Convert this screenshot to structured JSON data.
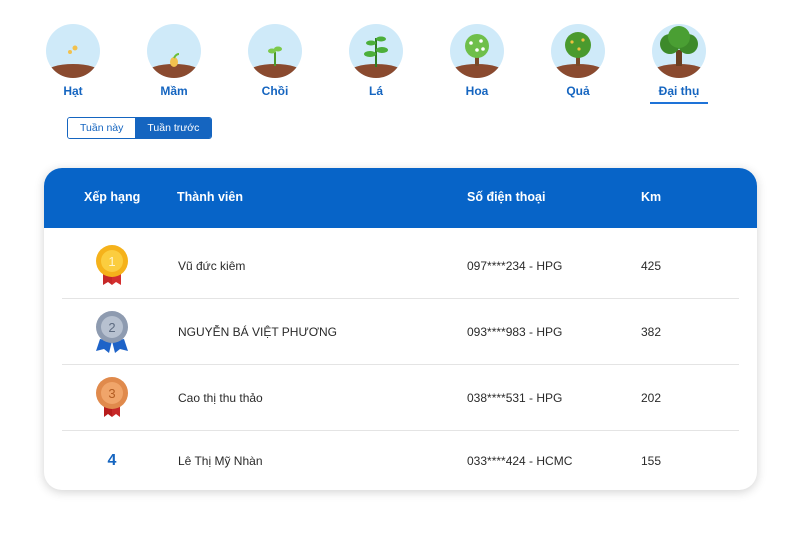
{
  "stages": [
    {
      "label": "Hạt",
      "icon": "seed-icon"
    },
    {
      "label": "Mầm",
      "icon": "sprout-icon"
    },
    {
      "label": "Chồi",
      "icon": "bud-icon"
    },
    {
      "label": "Lá",
      "icon": "leaf-plant-icon"
    },
    {
      "label": "Hoa",
      "icon": "flower-tree-icon"
    },
    {
      "label": "Quả",
      "icon": "fruit-tree-icon"
    },
    {
      "label": "Đại thụ",
      "icon": "big-tree-icon"
    }
  ],
  "active_stage": "Đại thụ",
  "week_toggle": {
    "this_week": "Tuần này",
    "last_week": "Tuần trước",
    "selected": "Tuần trước"
  },
  "table": {
    "headers": {
      "rank": "Xếp hạng",
      "member": "Thành viên",
      "phone": "Số điện thoại",
      "km": "Km"
    },
    "rows": [
      {
        "rank": "1",
        "name": "Vũ đức kiêm",
        "phone": "097****234 - HPG",
        "km": "425",
        "medal": "gold"
      },
      {
        "rank": "2",
        "name": "NGUYỄN BÁ VIỆT PHƯƠNG",
        "phone": "093****983 - HPG",
        "km": "382",
        "medal": "silver"
      },
      {
        "rank": "3",
        "name": "Cao thị thu thảo",
        "phone": "038****531 - HPG",
        "km": "202",
        "medal": "bronze"
      },
      {
        "rank": "4",
        "name": "Lê Thị Mỹ Nhàn",
        "phone": "033****424 - HCMC",
        "km": "155",
        "medal": ""
      }
    ]
  },
  "colors": {
    "primary": "#0764c8",
    "gold": "#f5b21b",
    "silver": "#8e9bb0",
    "bronze": "#e08a4c"
  }
}
